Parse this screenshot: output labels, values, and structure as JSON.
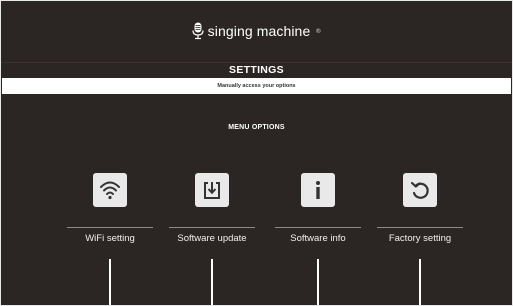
{
  "header": {
    "logo_text": "singing machine",
    "logo_mark": "®",
    "logo_icon": "microphone-icon"
  },
  "page": {
    "title": "SETTINGS",
    "subtitle": "Manually access your options",
    "menu_heading": "MENU OPTIONS"
  },
  "options": [
    {
      "label": "WiFi setting",
      "icon": "wifi-icon"
    },
    {
      "label": "Software update",
      "icon": "download-icon"
    },
    {
      "label": "Software info",
      "icon": "info-icon"
    },
    {
      "label": "Factory setting",
      "icon": "reset-icon"
    }
  ],
  "colors": {
    "background": "#2b2523",
    "icon_tile": "#e9e9e9",
    "text": "#ffffff"
  }
}
